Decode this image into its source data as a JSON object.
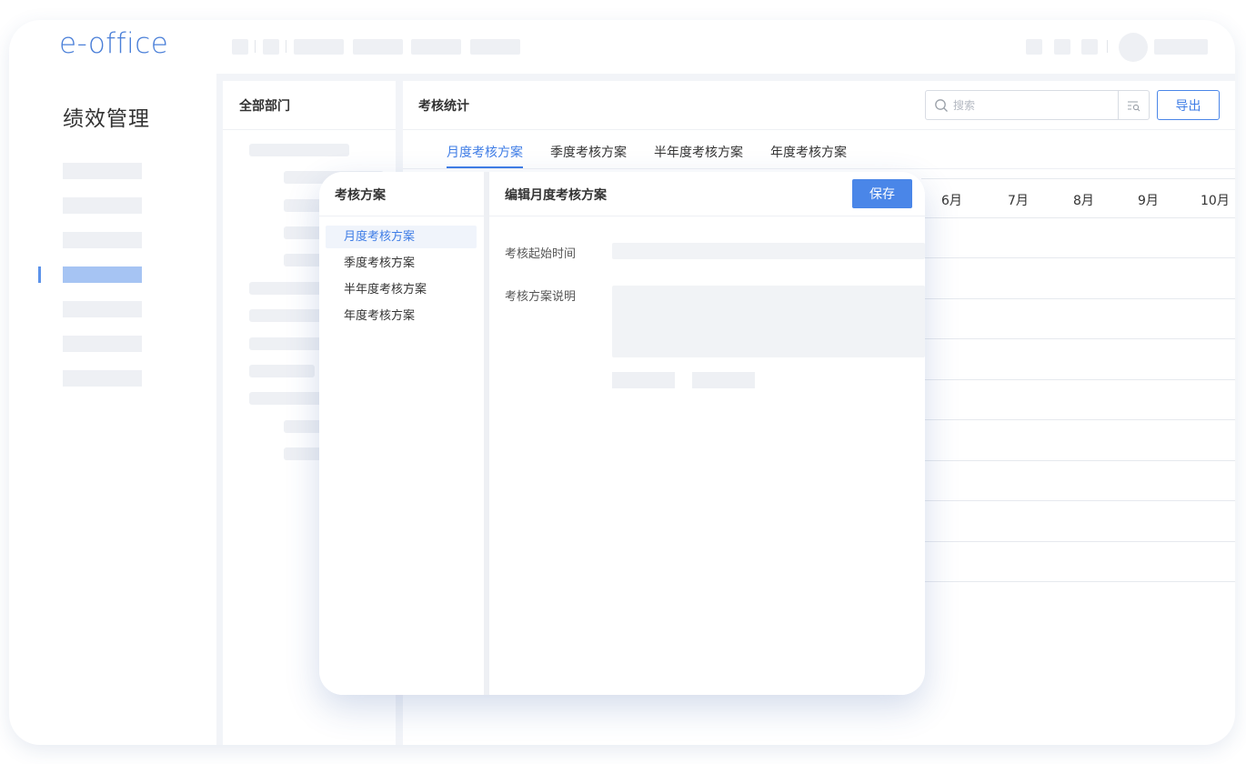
{
  "app": {
    "logo": "e-office"
  },
  "nav": {
    "module_title": "绩效管理",
    "active_index": 3
  },
  "dept_panel": {
    "title": "全部部门"
  },
  "main": {
    "title": "考核统计",
    "search_placeholder": "搜索",
    "export_label": "导出",
    "tabs": [
      "月度考核方案",
      "季度考核方案",
      "半年度考核方案",
      "年度考核方案"
    ],
    "active_tab": "月度考核方案",
    "months": [
      "6月",
      "7月",
      "8月",
      "9月",
      "10月"
    ]
  },
  "modal": {
    "left_title": "考核方案",
    "plans": [
      "月度考核方案",
      "季度考核方案",
      "半年度考核方案",
      "年度考核方案"
    ],
    "active_plan": "月度考核方案",
    "right_title": "编辑月度考核方案",
    "save_label": "保存",
    "fields": {
      "start_time_label": "考核起始时间",
      "description_label": "考核方案说明"
    }
  },
  "colors": {
    "accent": "#4a86e8",
    "nav_active": "#a6c4f3",
    "placeholder": "#eef0f4"
  },
  "icons": {
    "search": "search-icon",
    "filter": "filter-icon"
  }
}
